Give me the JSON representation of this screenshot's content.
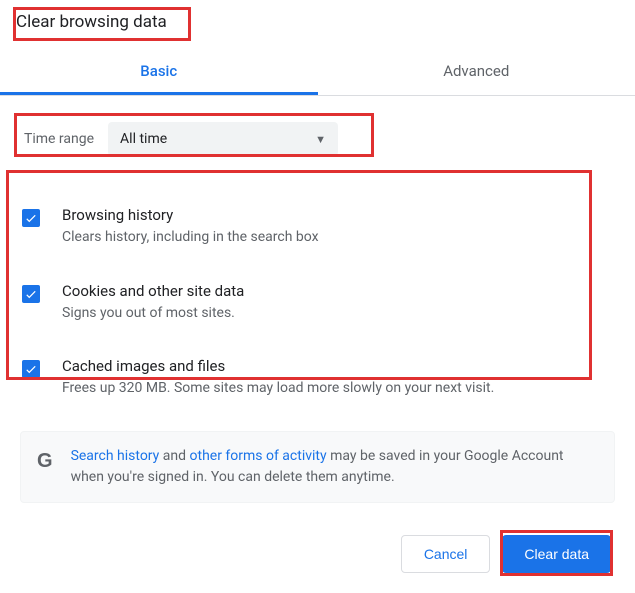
{
  "title": "Clear browsing data",
  "tabs": {
    "basic": "Basic",
    "advanced": "Advanced"
  },
  "timerange": {
    "label": "Time range",
    "value": "All time"
  },
  "items": [
    {
      "title": "Browsing history",
      "desc": "Clears history, including in the search box"
    },
    {
      "title": "Cookies and other site data",
      "desc": "Signs you out of most sites."
    },
    {
      "title": "Cached images and files",
      "desc": "Frees up 320 MB. Some sites may load more slowly on your next visit."
    }
  ],
  "notice": {
    "link1": "Search history",
    "mid1": " and ",
    "link2": "other forms of activity",
    "rest": " may be saved in your Google Account when you're signed in. You can delete them anytime."
  },
  "buttons": {
    "cancel": "Cancel",
    "clear": "Clear data"
  }
}
